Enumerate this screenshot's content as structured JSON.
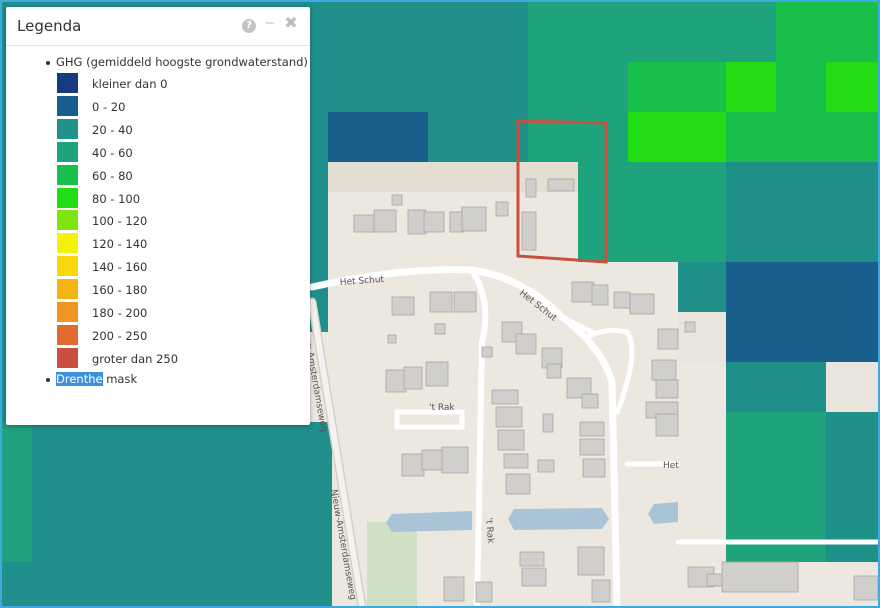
{
  "legend": {
    "title": "Legenda",
    "help_icon": "?",
    "minimize_icon": "‒",
    "close_icon": "✖",
    "layer_ghg": "GHG (gemiddeld hoogste grondwaterstand)",
    "layer_mask_selected": "Drenthe",
    "layer_mask_rest": " mask",
    "classes": [
      {
        "label": "kleiner dan 0",
        "color": "#173a80"
      },
      {
        "label": "0 - 20",
        "color": "#175e8e"
      },
      {
        "label": "20 - 40",
        "color": "#21918c"
      },
      {
        "label": "40 - 60",
        "color": "#1fa37c"
      },
      {
        "label": "60 - 80",
        "color": "#17c04a"
      },
      {
        "label": "80 - 100",
        "color": "#23dd14"
      },
      {
        "label": "100 - 120",
        "color": "#7ee40f"
      },
      {
        "label": "120 - 140",
        "color": "#f2f20a"
      },
      {
        "label": "140 - 160",
        "color": "#fad60c"
      },
      {
        "label": "160 - 180",
        "color": "#f4b415"
      },
      {
        "label": "180 - 200",
        "color": "#ee9621"
      },
      {
        "label": "200 - 250",
        "color": "#e06d2f"
      },
      {
        "label": "groter dan 250",
        "color": "#c9503e"
      }
    ]
  },
  "map": {
    "street_labels": [
      "Het Schut",
      "Het Schut",
      "Nieuw-Amsterdamseweg",
      "Nieuw-Amsterdamseweg",
      "'t Rak",
      "'t Rak",
      "Het"
    ],
    "frame_color": "#3fa9e0",
    "selection_color": "#c9503e"
  }
}
